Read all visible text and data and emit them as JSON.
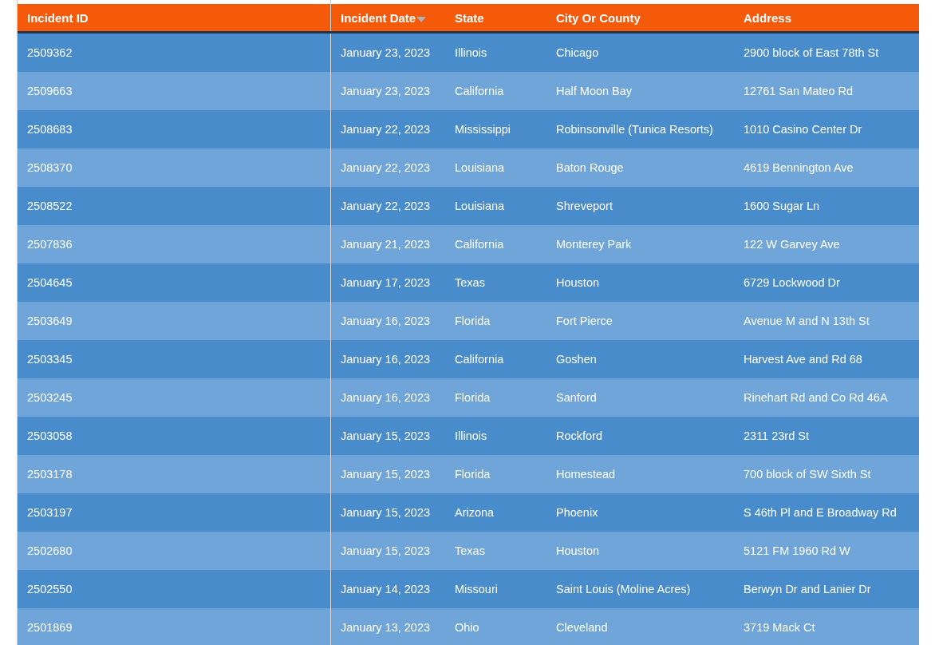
{
  "table": {
    "columns": [
      {
        "label": "Incident ID",
        "sorted": false
      },
      {
        "label": "Incident Date",
        "sorted": true
      },
      {
        "label": "State",
        "sorted": false
      },
      {
        "label": "City Or County",
        "sorted": false
      },
      {
        "label": "Address",
        "sorted": false
      }
    ],
    "rows": [
      [
        "2509362",
        "January 23, 2023",
        "Illinois",
        "Chicago",
        "2900 block of East 78th St"
      ],
      [
        "2509663",
        "January 23, 2023",
        "California",
        "Half Moon Bay",
        "12761 San Mateo Rd"
      ],
      [
        "2508683",
        "January 22, 2023",
        "Mississippi",
        "Robinsonville (Tunica Resorts)",
        "1010 Casino Center Dr"
      ],
      [
        "2508370",
        "January 22, 2023",
        "Louisiana",
        "Baton Rouge",
        "4619 Bennington Ave"
      ],
      [
        "2508522",
        "January 22, 2023",
        "Louisiana",
        "Shreveport",
        "1600 Sugar Ln"
      ],
      [
        "2507836",
        "January 21, 2023",
        "California",
        "Monterey Park",
        "122 W Garvey Ave"
      ],
      [
        "2504645",
        "January 17, 2023",
        "Texas",
        "Houston",
        "6729 Lockwood Dr"
      ],
      [
        "2503649",
        "January 16, 2023",
        "Florida",
        "Fort Pierce",
        "Avenue M and N 13th St"
      ],
      [
        "2503345",
        "January 16, 2023",
        "California",
        "Goshen",
        "Harvest Ave and Rd 68"
      ],
      [
        "2503245",
        "January 16, 2023",
        "Florida",
        "Sanford",
        "Rinehart Rd and Co Rd 46A"
      ],
      [
        "2503058",
        "January 15, 2023",
        "Illinois",
        "Rockford",
        "2311 23rd St"
      ],
      [
        "2503178",
        "January 15, 2023",
        "Florida",
        "Homestead",
        "700 block of SW Sixth St"
      ],
      [
        "2503197",
        "January 15, 2023",
        "Arizona",
        "Phoenix",
        "S 46th Pl and E Broadway Rd"
      ],
      [
        "2502680",
        "January 15, 2023",
        "Texas",
        "Houston",
        "5121 FM 1960 Rd W"
      ],
      [
        "2502550",
        "January 14, 2023",
        "Missouri",
        "Saint Louis (Moline Acres)",
        "Berwyn Dr and Lanier Dr"
      ],
      [
        "2501869",
        "January 13, 2023",
        "Ohio",
        "Cleveland",
        "3719 Mack Ct"
      ]
    ]
  }
}
